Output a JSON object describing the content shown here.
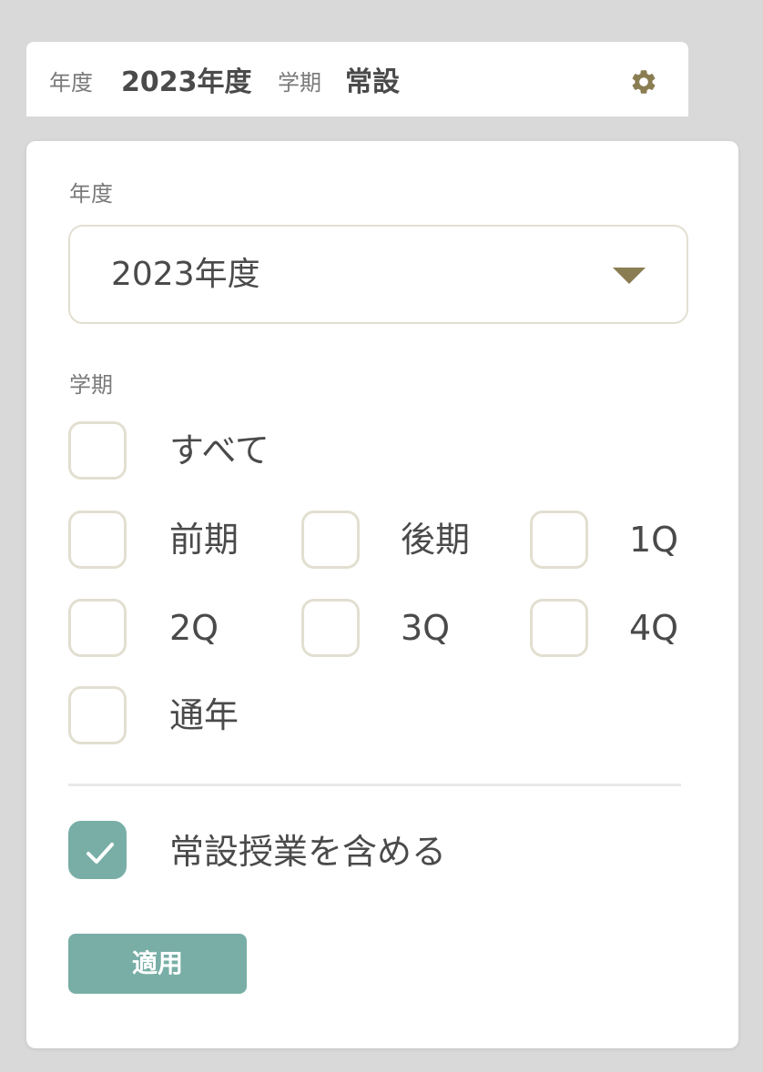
{
  "summary": {
    "year_label": "年度",
    "year_value": "2023年度",
    "term_label": "学期",
    "term_value": "常設",
    "settings_icon": "gear-icon",
    "icon_color": "#8a7d52"
  },
  "filter": {
    "year_section_label": "年度",
    "year_select": {
      "selected": "2023年度"
    },
    "term_section_label": "学期",
    "terms": [
      {
        "label": "すべて",
        "checked": false
      },
      {
        "label": "前期",
        "checked": false
      },
      {
        "label": "後期",
        "checked": false
      },
      {
        "label": "1Q",
        "checked": false
      },
      {
        "label": "2Q",
        "checked": false
      },
      {
        "label": "3Q",
        "checked": false
      },
      {
        "label": "4Q",
        "checked": false
      },
      {
        "label": "通年",
        "checked": false
      }
    ],
    "include_permanent": {
      "label": "常設授業を含める",
      "checked": true
    },
    "apply_label": "適用"
  },
  "colors": {
    "accent": "#78aea6",
    "checkbox_border": "#e2dfd1",
    "caret": "#8a7d52"
  }
}
